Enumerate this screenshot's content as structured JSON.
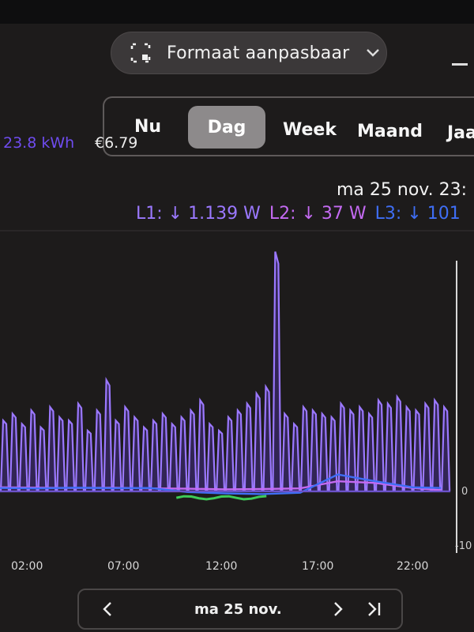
{
  "window": {
    "resize_label": "Formaat aanpasbaar"
  },
  "tabs": [
    {
      "label": "Nu"
    },
    {
      "label": "Dag",
      "active": true
    },
    {
      "label": "Week"
    },
    {
      "label": "Maand"
    },
    {
      "label": "Jaa"
    }
  ],
  "summary": {
    "energy": "23.8 kWh",
    "cost": "€6.79"
  },
  "tooltip": {
    "datetime": "ma 25 nov. 23:",
    "l1": "L1: ↓ 1.139 W",
    "l2": "L2: ↓ 37 W",
    "l3": "L3: ↓ 101"
  },
  "navigation": {
    "date": "ma 25 nov."
  },
  "colors": {
    "l1": "#9b78ff",
    "l2": "#c46af2",
    "l3": "#3f6ef5",
    "accent": "#6f4cf0"
  },
  "chart_data": {
    "type": "line",
    "x_ticks": [
      "02:00",
      "07:00",
      "12:00",
      "17:00",
      "22:00"
    ],
    "y_ticks": [
      "0",
      "-10"
    ],
    "series": [
      {
        "name": "L1",
        "color": "#9b78ff",
        "x": [
          0.0,
          0.5,
          1.0,
          1.5,
          2.0,
          2.5,
          3.0,
          3.5,
          4.0,
          4.5,
          5.0,
          5.5,
          6.0,
          6.5,
          7.0,
          7.5,
          8.0,
          8.5,
          9.0,
          9.5,
          10.0,
          10.5,
          11.0,
          11.5,
          12.0,
          12.5,
          13.0,
          13.5,
          14.0,
          14.5,
          15.0,
          15.5,
          16.0,
          16.5,
          17.0,
          17.5,
          18.0,
          18.5,
          19.0,
          19.5,
          20.0,
          20.5,
          21.0,
          21.5,
          22.0,
          22.5,
          23.0,
          23.5
        ],
        "y": [
          2100,
          2300,
          2000,
          2400,
          1900,
          2500,
          2200,
          2100,
          2600,
          1800,
          2400,
          3300,
          2100,
          2500,
          2200,
          1900,
          2100,
          2300,
          2000,
          2200,
          2400,
          2700,
          2000,
          1800,
          2200,
          2400,
          2600,
          2900,
          3100,
          7100,
          2300,
          2000,
          2500,
          2400,
          2300,
          2200,
          2600,
          2400,
          2500,
          2300,
          2700,
          2600,
          2800,
          2500,
          2400,
          2600,
          2700,
          2500
        ]
      },
      {
        "name": "L2",
        "color": "#c46af2",
        "x": [
          0,
          2,
          4,
          6,
          8,
          10,
          12,
          14,
          16,
          18,
          20,
          22,
          23.5
        ],
        "y": [
          120,
          110,
          100,
          110,
          90,
          80,
          60,
          70,
          90,
          300,
          250,
          100,
          37
        ]
      },
      {
        "name": "L3",
        "color": "#3f6ef5",
        "x": [
          0,
          2,
          4,
          6,
          8,
          10,
          12,
          14,
          16,
          18,
          20,
          22,
          23.5
        ],
        "y": [
          101,
          90,
          110,
          95,
          100,
          -20,
          -60,
          -80,
          -40,
          500,
          300,
          120,
          101
        ]
      }
    ]
  }
}
